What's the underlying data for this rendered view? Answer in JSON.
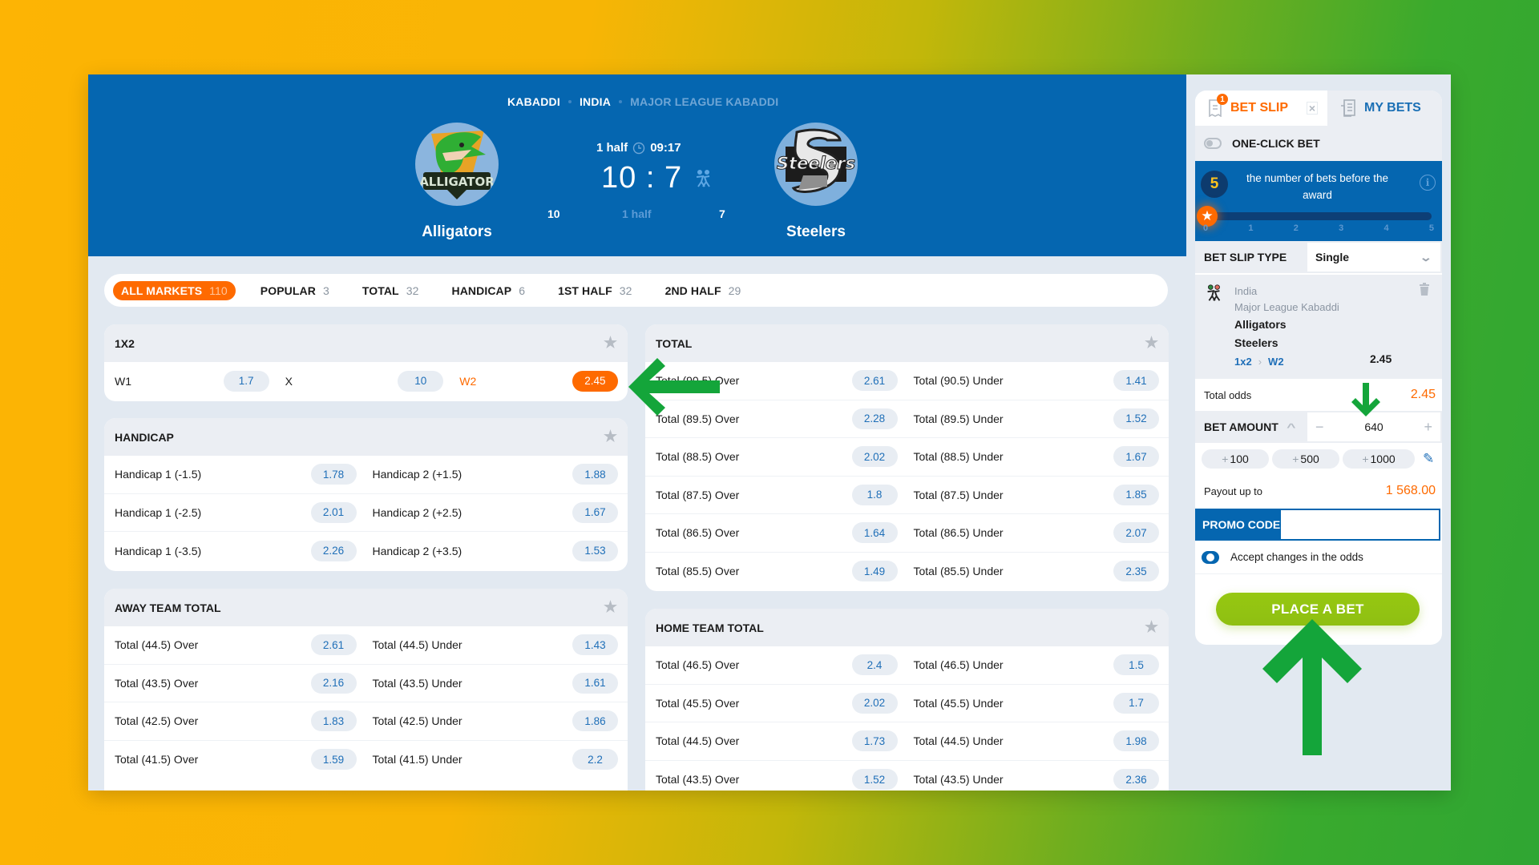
{
  "header": {
    "breadcrumbs": [
      "KABADDI",
      "INDIA",
      "MAJOR LEAGUE KABADDI"
    ],
    "home_team": "Alligators",
    "away_team": "Steelers",
    "period": "1 half",
    "clock": "09:17",
    "score": "10 : 7",
    "home_period_score": "10",
    "period_label": "1 half",
    "away_period_score": "7",
    "home_logo_text": "ALLIGATOR",
    "away_logo_text": "Steelers"
  },
  "tabs": [
    {
      "label": "ALL MARKETS",
      "count": "110",
      "active": true
    },
    {
      "label": "POPULAR",
      "count": "3"
    },
    {
      "label": "TOTAL",
      "count": "32"
    },
    {
      "label": "HANDICAP",
      "count": "6"
    },
    {
      "label": "1ST HALF",
      "count": "32"
    },
    {
      "label": "2ND HALF",
      "count": "29"
    }
  ],
  "markets": {
    "m1x2": {
      "title": "1X2",
      "outcomes": [
        {
          "label": "W1",
          "odd": "1.7"
        },
        {
          "label": "X",
          "odd": "10"
        },
        {
          "label": "W2",
          "odd": "2.45",
          "selected": true
        }
      ]
    },
    "handicap": {
      "title": "HANDICAP",
      "rows": [
        {
          "l1": "Handicap 1 (-1.5)",
          "o1": "1.78",
          "l2": "Handicap 2 (+1.5)",
          "o2": "1.88"
        },
        {
          "l1": "Handicap 1 (-2.5)",
          "o1": "2.01",
          "l2": "Handicap 2 (+2.5)",
          "o2": "1.67"
        },
        {
          "l1": "Handicap 1 (-3.5)",
          "o1": "2.26",
          "l2": "Handicap 2 (+3.5)",
          "o2": "1.53"
        }
      ]
    },
    "away_total": {
      "title": "AWAY TEAM TOTAL",
      "rows": [
        {
          "l1": "Total (44.5) Over",
          "o1": "2.61",
          "l2": "Total (44.5) Under",
          "o2": "1.43"
        },
        {
          "l1": "Total (43.5) Over",
          "o1": "2.16",
          "l2": "Total (43.5) Under",
          "o2": "1.61"
        },
        {
          "l1": "Total (42.5) Over",
          "o1": "1.83",
          "l2": "Total (42.5) Under",
          "o2": "1.86"
        },
        {
          "l1": "Total (41.5) Over",
          "o1": "1.59",
          "l2": "Total (41.5) Under",
          "o2": "2.2"
        }
      ]
    },
    "total": {
      "title": "TOTAL",
      "rows": [
        {
          "l1": "Total (90.5) Over",
          "o1": "2.61",
          "l2": "Total (90.5) Under",
          "o2": "1.41"
        },
        {
          "l1": "Total (89.5) Over",
          "o1": "2.28",
          "l2": "Total (89.5) Under",
          "o2": "1.52"
        },
        {
          "l1": "Total (88.5) Over",
          "o1": "2.02",
          "l2": "Total (88.5) Under",
          "o2": "1.67"
        },
        {
          "l1": "Total (87.5) Over",
          "o1": "1.8",
          "l2": "Total (87.5) Under",
          "o2": "1.85"
        },
        {
          "l1": "Total (86.5) Over",
          "o1": "1.64",
          "l2": "Total (86.5) Under",
          "o2": "2.07"
        },
        {
          "l1": "Total (85.5) Over",
          "o1": "1.49",
          "l2": "Total (85.5) Under",
          "o2": "2.35"
        }
      ]
    },
    "home_total": {
      "title": "HOME TEAM TOTAL",
      "rows": [
        {
          "l1": "Total (46.5) Over",
          "o1": "2.4",
          "l2": "Total (46.5) Under",
          "o2": "1.5"
        },
        {
          "l1": "Total (45.5) Over",
          "o1": "2.02",
          "l2": "Total (45.5) Under",
          "o2": "1.7"
        },
        {
          "l1": "Total (44.5) Over",
          "o1": "1.73",
          "l2": "Total (44.5) Under",
          "o2": "1.98"
        },
        {
          "l1": "Total (43.5) Over",
          "o1": "1.52",
          "l2": "Total (43.5) Under",
          "o2": "2.36"
        }
      ]
    }
  },
  "betslip": {
    "tab_betslip": "BET SLIP",
    "tab_betslip_badge": "1",
    "tab_mybets": "MY BETS",
    "close_glyph": "×",
    "one_click_label": "ONE-CLICK BET",
    "award_count": "5",
    "award_text": "the number of bets before the award",
    "award_progress": 0,
    "award_ticks": [
      "0",
      "1",
      "2",
      "3",
      "4",
      "5"
    ],
    "type_label": "BET SLIP TYPE",
    "type_value": "Single",
    "item": {
      "country": "India",
      "league": "Major League Kabaddi",
      "team1": "Alligators",
      "team2": "Steelers",
      "market": "1x2",
      "market_sep": "›",
      "outcome": "W2",
      "odd": "2.45"
    },
    "total_odds_label": "Total odds",
    "total_odds_value": "2.45",
    "amount_label": "BET AMOUNT",
    "amount_value": "640",
    "minus": "−",
    "plus": "+",
    "quick_amounts": [
      "100",
      "500",
      "1000"
    ],
    "payout_label": "Payout up to",
    "payout_value": "1 568.00",
    "promo_label": "PROMO CODE",
    "promo_value": "",
    "accept_label": "Accept changes in the odds",
    "place_button": "PLACE A BET"
  },
  "colors": {
    "brand_blue": "#0566b0",
    "accent_orange": "#fe6a00",
    "odds_blue": "#1f6fb8",
    "place_green": "#92c511",
    "annotation_arrow_green": "#14a53a"
  }
}
